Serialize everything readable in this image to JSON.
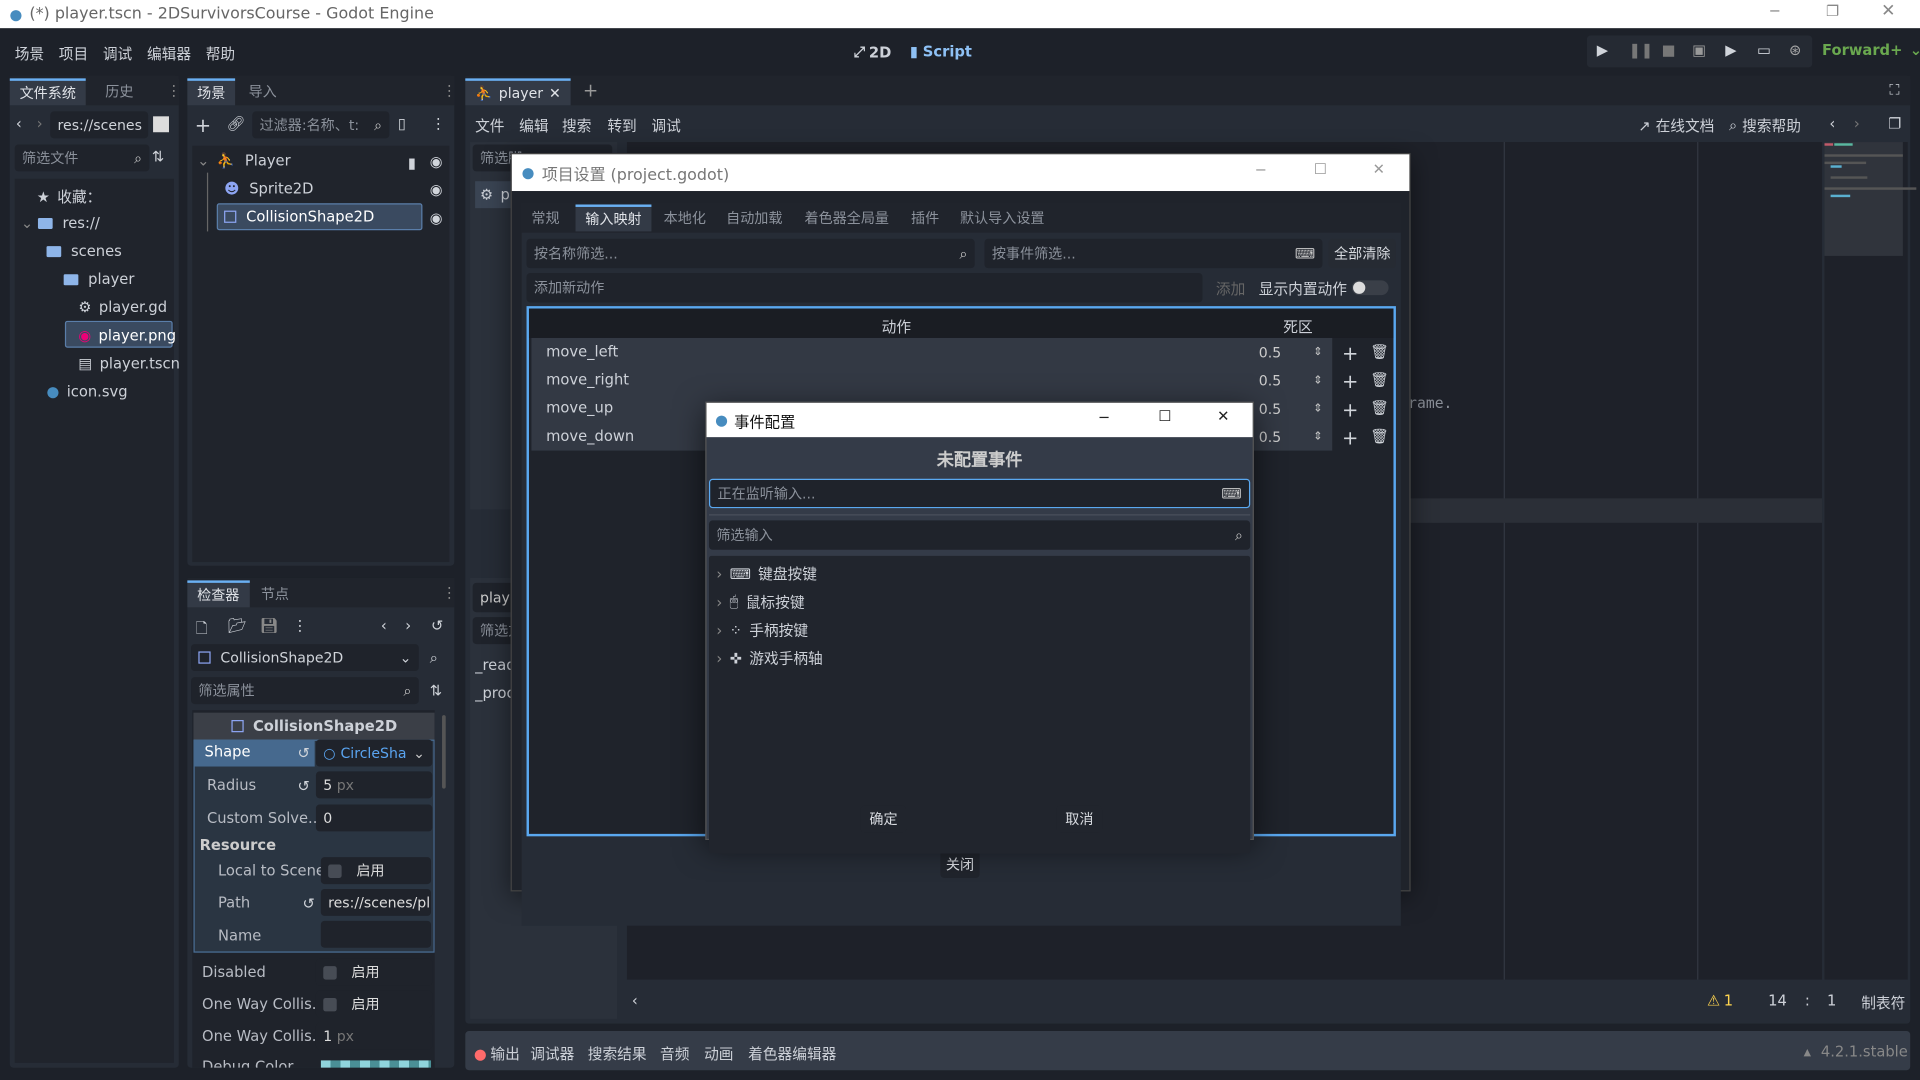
{
  "window": {
    "title": "(*) player.tscn - 2DSurvivorsCourse - Godot Engine"
  },
  "menu": {
    "items": [
      "场景",
      "项目",
      "调试",
      "编辑器",
      "帮助"
    ],
    "mode_2d": "2D",
    "mode_script": "Script",
    "renderer": "Forward+"
  },
  "filesystem": {
    "tabs": [
      "文件系统",
      "历史"
    ],
    "path": "res://scenes",
    "filter_placeholder": "筛选文件",
    "items": [
      {
        "label": "收藏："
      },
      {
        "label": "res://"
      },
      {
        "label": "scenes"
      },
      {
        "label": "player"
      },
      {
        "label": "player.gd"
      },
      {
        "label": "player.png"
      },
      {
        "label": "player.tscn"
      },
      {
        "label": "icon.svg"
      }
    ]
  },
  "scene": {
    "tabs": [
      "场景",
      "导入"
    ],
    "filter_placeholder": "过滤器:名称、t:",
    "nodes": [
      "Player",
      "Sprite2D",
      "CollisionShape2D"
    ]
  },
  "inspector": {
    "tabs": [
      "检查器",
      "节点"
    ],
    "object": "CollisionShape2D",
    "filter_placeholder": "筛选属性",
    "section": "CollisionShape2D",
    "shape_label": "Shape",
    "shape_value": "CircleSha",
    "radius_label": "Radius",
    "radius_value": "5",
    "unit": "px",
    "custom_label": "Custom Solve...",
    "custom_value": "0",
    "resource_header": "Resource",
    "local_label": "Local to Scene",
    "on": "启用",
    "path_label": "Path",
    "path_value": "res://scenes/pl",
    "name_label": "Name",
    "disabled_label": "Disabled",
    "oneway_label": "One Way Collis...",
    "oneway_margin_label": "One Way Collis...",
    "oneway_margin_value": "1",
    "debug_label": "Debug Color"
  },
  "editor": {
    "tab": "player",
    "menu": [
      "文件",
      "编辑",
      "搜索",
      "转到",
      "调试"
    ],
    "online_docs": "在线文档",
    "search_help": "搜索帮助",
    "script_filter": "筛选脚",
    "script_item": "pl",
    "method_header": "playe",
    "method_filter": "筛选方",
    "methods": [
      "_ready",
      "_proce"
    ],
    "code_fragment": "rame.",
    "warnings": "1",
    "line": "14",
    "col": "1",
    "indent": "制表符"
  },
  "bottom": {
    "tabs": [
      "输出",
      "调试器",
      "搜索结果",
      "音频",
      "动画",
      "着色器编辑器"
    ],
    "version": "4.2.1.stable"
  },
  "project_settings": {
    "title": "项目设置 (project.godot)",
    "tabs": [
      "常规",
      "输入映射",
      "本地化",
      "自动加载",
      "着色器全局量",
      "插件",
      "默认导入设置"
    ],
    "active_tab": 1,
    "filter_name": "按名称筛选...",
    "filter_event": "按事件筛选...",
    "clear_all": "全部清除",
    "add_placeholder": "添加新动作",
    "add": "添加",
    "show_builtin": "显示内置动作",
    "col_action": "动作",
    "col_deadzone": "死区",
    "actions": [
      {
        "name": "move_left",
        "deadzone": "0.5"
      },
      {
        "name": "move_right",
        "deadzone": "0.5"
      },
      {
        "name": "move_up",
        "deadzone": "0.5"
      },
      {
        "name": "move_down",
        "deadzone": "0.5"
      }
    ],
    "close": "关闭"
  },
  "event_dialog": {
    "title": "事件配置",
    "heading": "未配置事件",
    "listen_placeholder": "正在监听输入...",
    "filter_placeholder": "筛选输入",
    "categories": [
      "键盘按键",
      "鼠标按键",
      "手柄按键",
      "游戏手柄轴"
    ],
    "ok": "确定",
    "cancel": "取消"
  },
  "colors": {
    "accent": "#6ab0f3",
    "renderer": "#6aa84f",
    "warning": "#ffd54f",
    "error_dot": "#ff6b6b"
  }
}
